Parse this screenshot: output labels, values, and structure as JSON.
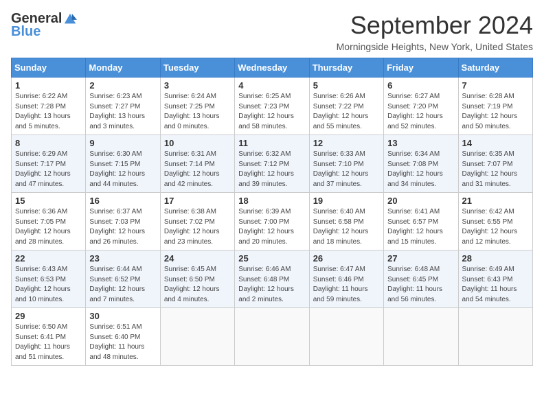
{
  "header": {
    "logo_general": "General",
    "logo_blue": "Blue",
    "month_title": "September 2024",
    "location": "Morningside Heights, New York, United States"
  },
  "weekdays": [
    "Sunday",
    "Monday",
    "Tuesday",
    "Wednesday",
    "Thursday",
    "Friday",
    "Saturday"
  ],
  "weeks": [
    [
      {
        "day": "1",
        "info": "Sunrise: 6:22 AM\nSunset: 7:28 PM\nDaylight: 13 hours\nand 5 minutes."
      },
      {
        "day": "2",
        "info": "Sunrise: 6:23 AM\nSunset: 7:27 PM\nDaylight: 13 hours\nand 3 minutes."
      },
      {
        "day": "3",
        "info": "Sunrise: 6:24 AM\nSunset: 7:25 PM\nDaylight: 13 hours\nand 0 minutes."
      },
      {
        "day": "4",
        "info": "Sunrise: 6:25 AM\nSunset: 7:23 PM\nDaylight: 12 hours\nand 58 minutes."
      },
      {
        "day": "5",
        "info": "Sunrise: 6:26 AM\nSunset: 7:22 PM\nDaylight: 12 hours\nand 55 minutes."
      },
      {
        "day": "6",
        "info": "Sunrise: 6:27 AM\nSunset: 7:20 PM\nDaylight: 12 hours\nand 52 minutes."
      },
      {
        "day": "7",
        "info": "Sunrise: 6:28 AM\nSunset: 7:19 PM\nDaylight: 12 hours\nand 50 minutes."
      }
    ],
    [
      {
        "day": "8",
        "info": "Sunrise: 6:29 AM\nSunset: 7:17 PM\nDaylight: 12 hours\nand 47 minutes."
      },
      {
        "day": "9",
        "info": "Sunrise: 6:30 AM\nSunset: 7:15 PM\nDaylight: 12 hours\nand 44 minutes."
      },
      {
        "day": "10",
        "info": "Sunrise: 6:31 AM\nSunset: 7:14 PM\nDaylight: 12 hours\nand 42 minutes."
      },
      {
        "day": "11",
        "info": "Sunrise: 6:32 AM\nSunset: 7:12 PM\nDaylight: 12 hours\nand 39 minutes."
      },
      {
        "day": "12",
        "info": "Sunrise: 6:33 AM\nSunset: 7:10 PM\nDaylight: 12 hours\nand 37 minutes."
      },
      {
        "day": "13",
        "info": "Sunrise: 6:34 AM\nSunset: 7:08 PM\nDaylight: 12 hours\nand 34 minutes."
      },
      {
        "day": "14",
        "info": "Sunrise: 6:35 AM\nSunset: 7:07 PM\nDaylight: 12 hours\nand 31 minutes."
      }
    ],
    [
      {
        "day": "15",
        "info": "Sunrise: 6:36 AM\nSunset: 7:05 PM\nDaylight: 12 hours\nand 28 minutes."
      },
      {
        "day": "16",
        "info": "Sunrise: 6:37 AM\nSunset: 7:03 PM\nDaylight: 12 hours\nand 26 minutes."
      },
      {
        "day": "17",
        "info": "Sunrise: 6:38 AM\nSunset: 7:02 PM\nDaylight: 12 hours\nand 23 minutes."
      },
      {
        "day": "18",
        "info": "Sunrise: 6:39 AM\nSunset: 7:00 PM\nDaylight: 12 hours\nand 20 minutes."
      },
      {
        "day": "19",
        "info": "Sunrise: 6:40 AM\nSunset: 6:58 PM\nDaylight: 12 hours\nand 18 minutes."
      },
      {
        "day": "20",
        "info": "Sunrise: 6:41 AM\nSunset: 6:57 PM\nDaylight: 12 hours\nand 15 minutes."
      },
      {
        "day": "21",
        "info": "Sunrise: 6:42 AM\nSunset: 6:55 PM\nDaylight: 12 hours\nand 12 minutes."
      }
    ],
    [
      {
        "day": "22",
        "info": "Sunrise: 6:43 AM\nSunset: 6:53 PM\nDaylight: 12 hours\nand 10 minutes."
      },
      {
        "day": "23",
        "info": "Sunrise: 6:44 AM\nSunset: 6:52 PM\nDaylight: 12 hours\nand 7 minutes."
      },
      {
        "day": "24",
        "info": "Sunrise: 6:45 AM\nSunset: 6:50 PM\nDaylight: 12 hours\nand 4 minutes."
      },
      {
        "day": "25",
        "info": "Sunrise: 6:46 AM\nSunset: 6:48 PM\nDaylight: 12 hours\nand 2 minutes."
      },
      {
        "day": "26",
        "info": "Sunrise: 6:47 AM\nSunset: 6:46 PM\nDaylight: 11 hours\nand 59 minutes."
      },
      {
        "day": "27",
        "info": "Sunrise: 6:48 AM\nSunset: 6:45 PM\nDaylight: 11 hours\nand 56 minutes."
      },
      {
        "day": "28",
        "info": "Sunrise: 6:49 AM\nSunset: 6:43 PM\nDaylight: 11 hours\nand 54 minutes."
      }
    ],
    [
      {
        "day": "29",
        "info": "Sunrise: 6:50 AM\nSunset: 6:41 PM\nDaylight: 11 hours\nand 51 minutes."
      },
      {
        "day": "30",
        "info": "Sunrise: 6:51 AM\nSunset: 6:40 PM\nDaylight: 11 hours\nand 48 minutes."
      },
      {
        "day": "",
        "info": ""
      },
      {
        "day": "",
        "info": ""
      },
      {
        "day": "",
        "info": ""
      },
      {
        "day": "",
        "info": ""
      },
      {
        "day": "",
        "info": ""
      }
    ]
  ]
}
